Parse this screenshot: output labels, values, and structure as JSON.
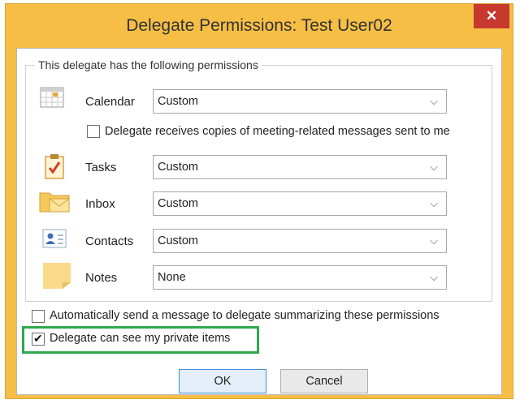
{
  "window": {
    "title": "Delegate Permissions: Test User02",
    "close_label": "✕"
  },
  "group": {
    "label": "This delegate has the following permissions"
  },
  "permissions": [
    {
      "label": "Calendar",
      "value": "Custom",
      "icon": "calendar-icon"
    },
    {
      "label": "Tasks",
      "value": "Custom",
      "icon": "tasks-icon"
    },
    {
      "label": "Inbox",
      "value": "Custom",
      "icon": "inbox-icon"
    },
    {
      "label": "Contacts",
      "value": "Custom",
      "icon": "contacts-icon"
    },
    {
      "label": "Notes",
      "value": "None",
      "icon": "notes-icon"
    }
  ],
  "calendar_copies": {
    "label": "Delegate receives copies of meeting-related messages sent to me",
    "checked": false
  },
  "auto_send": {
    "label": "Automatically send a message to delegate summarizing these permissions",
    "checked": false
  },
  "private_items": {
    "label": "Delegate can see my private items",
    "checked": true
  },
  "buttons": {
    "ok": "OK",
    "cancel": "Cancel"
  },
  "colors": {
    "title_bar": "#f6be45",
    "close_button": "#c7382f",
    "highlight": "#2fa84f"
  }
}
